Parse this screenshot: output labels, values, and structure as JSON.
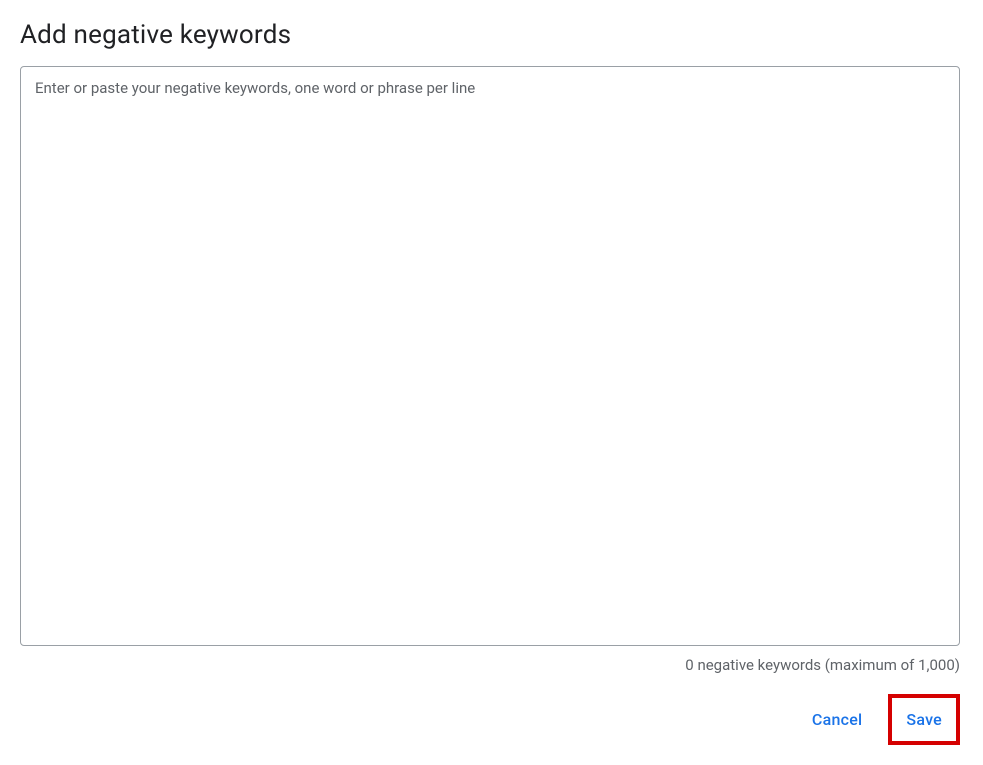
{
  "header": {
    "title": "Add negative keywords"
  },
  "form": {
    "keywords_placeholder": "Enter or paste your negative keywords, one word or phrase per line",
    "keywords_value": "",
    "status_text": "0 negative keywords (maximum of 1,000)"
  },
  "buttons": {
    "cancel_label": "Cancel",
    "save_label": "Save"
  }
}
